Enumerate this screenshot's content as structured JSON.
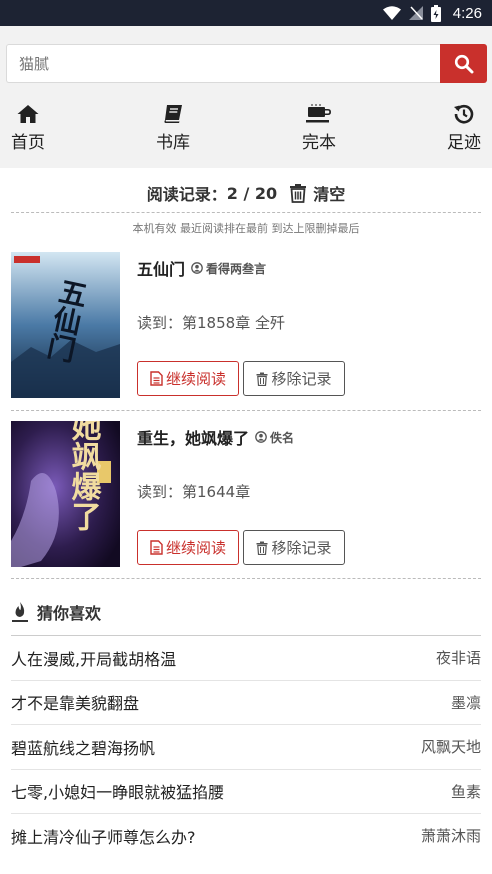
{
  "status_bar": {
    "time": "4:26"
  },
  "search": {
    "placeholder": "猫腻"
  },
  "nav": [
    {
      "icon": "home-icon",
      "label": "首页"
    },
    {
      "icon": "book-icon",
      "label": "书库"
    },
    {
      "icon": "cup-icon",
      "label": "完本"
    },
    {
      "icon": "history-icon",
      "label": "足迹"
    }
  ],
  "history": {
    "label": "阅读记录：",
    "count": "2 / 20",
    "clear_label": "清空",
    "note": "本机有效 最近阅读排在最前 到达上限删掉最后"
  },
  "books": [
    {
      "title": "五仙门",
      "author": "看得两叁言",
      "read_prefix": "读到：",
      "read_chapter": "第1858章 全歼",
      "continue_label": "继续阅读",
      "remove_label": "移除记录",
      "cover_text": "五仙门",
      "cover_colors": [
        "#b9d6e8",
        "#2e5d8a",
        "#0d1f33"
      ]
    },
    {
      "title": "重生，她飒爆了",
      "author": "佚名",
      "read_prefix": "读到：",
      "read_chapter": "第1644章",
      "continue_label": "继续阅读",
      "remove_label": "移除记录",
      "cover_text": "她飒爆了",
      "cover_colors": [
        "#3a2a5e",
        "#1b1030",
        "#6a4a9a"
      ]
    }
  ],
  "recommend": {
    "heading": "猜你喜欢",
    "items": [
      {
        "title": "人在漫威,开局截胡格温",
        "author": "夜非语"
      },
      {
        "title": "才不是靠美貌翻盘",
        "author": "墨凛"
      },
      {
        "title": "碧蓝航线之碧海扬帆",
        "author": "风飘天地"
      },
      {
        "title": "七零,小媳妇一睁眼就被猛掐腰",
        "author": "鱼素"
      },
      {
        "title": "摊上清冷仙子师尊怎么办?",
        "author": "萧萧沐雨"
      }
    ]
  },
  "colors": {
    "accent": "#c9302c",
    "status_bar": "#1d2333",
    "header_bg": "#f2f2f2"
  }
}
